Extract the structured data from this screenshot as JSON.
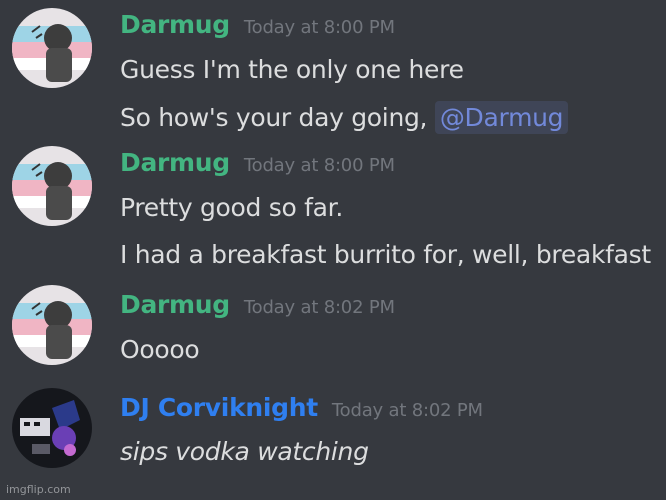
{
  "messages": [
    {
      "author": "Darmug",
      "timestamp": "Today at 8:00 PM",
      "author_color": "#43b581",
      "lines": [
        "Guess I'm the only one here",
        "So how's your day going, "
      ],
      "mention": "@Darmug"
    },
    {
      "author": "Darmug",
      "timestamp": "Today at 8:00 PM",
      "author_color": "#43b581",
      "lines": [
        "Pretty good so far.",
        "I had a breakfast burrito for, well, breakfast"
      ]
    },
    {
      "author": "Darmug",
      "timestamp": "Today at 8:02 PM",
      "author_color": "#43b581",
      "lines": [
        "Ooooo"
      ]
    },
    {
      "author": "DJ Corviknight",
      "timestamp": "Today at 8:02 PM",
      "author_color": "#2f7ff0",
      "lines": [
        "sips vodka watching"
      ]
    }
  ],
  "watermark": "imgflip.com",
  "colors": {
    "background": "#36393f",
    "message_text": "#dcddde",
    "timestamp": "#72767d",
    "mention": "#7289da"
  }
}
